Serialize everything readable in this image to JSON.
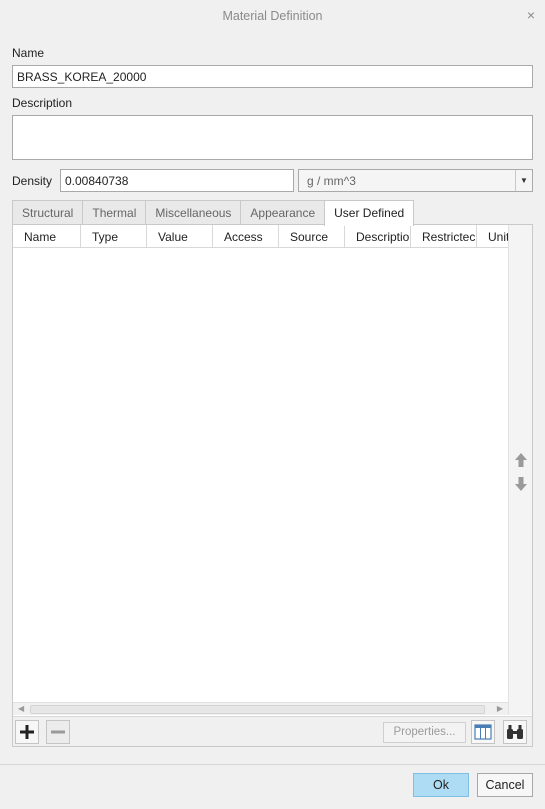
{
  "window": {
    "title": "Material Definition",
    "close_glyph": "×"
  },
  "name": {
    "label": "Name",
    "value": "BRASS_KOREA_20000"
  },
  "description": {
    "label": "Description",
    "value": ""
  },
  "density": {
    "label": "Density",
    "value": "0.00840738",
    "unit": "g / mm^3"
  },
  "tabs": [
    {
      "label": "Structural"
    },
    {
      "label": "Thermal"
    },
    {
      "label": "Miscellaneous"
    },
    {
      "label": "Appearance"
    },
    {
      "label": "User Defined"
    }
  ],
  "table": {
    "columns": [
      "Name",
      "Type",
      "Value",
      "Access",
      "Source",
      "Descriptio",
      "Restrictec",
      "Unit"
    ],
    "rows": []
  },
  "toolbar": {
    "properties_label": "Properties..."
  },
  "buttons": {
    "ok": "Ok",
    "cancel": "Cancel"
  },
  "icons": {
    "add": "plus-icon",
    "remove": "minus-icon",
    "columns": "table-columns-icon",
    "find": "binoculars-icon",
    "up": "arrow-up-icon",
    "down": "arrow-down-icon",
    "dropdown": "chevron-down-icon",
    "close": "close-icon"
  },
  "colors": {
    "ok_button": "#aedcf5",
    "background": "#f0f0f0"
  }
}
